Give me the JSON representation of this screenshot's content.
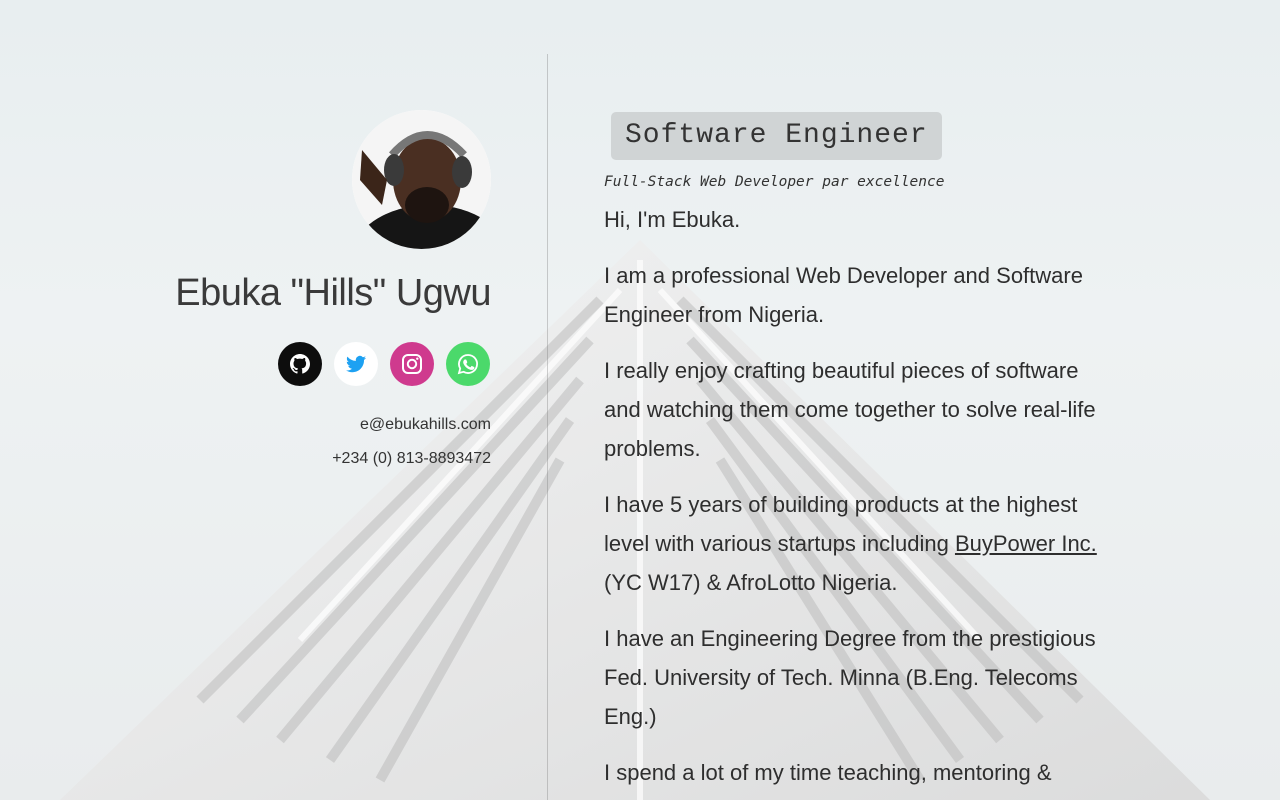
{
  "profile": {
    "name": "Ebuka \"Hills\" Ugwu",
    "email": "e@ebukahills.com",
    "phone": "+234 (0) 813-8893472"
  },
  "socials": [
    {
      "icon": "github-icon",
      "color": "#0d0d0d"
    },
    {
      "icon": "twitter-icon",
      "color": "#1da1f2"
    },
    {
      "icon": "instagram-icon",
      "color": "#cf3a8e"
    },
    {
      "icon": "whatsapp-icon",
      "color": "#4bd96b"
    }
  ],
  "about": {
    "title": "Software Engineer",
    "subtitle": "Full-Stack Web Developer par excellence",
    "greeting": "Hi, I'm Ebuka.",
    "p1": "I am a professional Web Developer and Software Engineer from Nigeria.",
    "p2": "I really enjoy crafting beautiful pieces of software and watching them come together to solve real-life problems.",
    "p3_before": "I have 5 years of building products at the highest level with various startups including ",
    "p3_link": "BuyPower Inc.",
    "p3_after": " (YC W17) & AfroLotto Nigeria.",
    "p4": "I have an Engineering Degree from the prestigious Fed. University of Tech. Minna (B.Eng. Telecoms Eng.)",
    "p5": "I spend a lot of my time teaching, mentoring &"
  }
}
